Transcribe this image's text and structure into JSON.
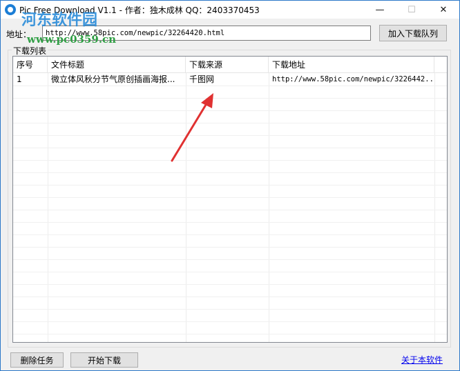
{
  "window": {
    "title": "Pic Free Download V1.1 - 作者：独木成林 QQ：2403370453",
    "controls": {
      "minimize": "—",
      "maximize": "☐",
      "close": "✕"
    }
  },
  "watermark": {
    "text": "河东软件园",
    "url": "www.pc0359.cn"
  },
  "address": {
    "label": "地址：",
    "value": "http://www.58pic.com/newpic/32264420.html",
    "add_button": "加入下载队列"
  },
  "download_list": {
    "legend": "下载列表",
    "columns": [
      "序号",
      "文件标题",
      "下载来源",
      "下载地址"
    ],
    "rows": [
      {
        "index": "1",
        "title": "微立体风秋分节气原创插画海报...",
        "source": "千图网",
        "url": "http://www.58pic.com/newpic/3226442..."
      }
    ]
  },
  "footer": {
    "delete_button": "删除任务",
    "start_button": "开始下载",
    "about_link": "关于本软件"
  },
  "colors": {
    "accent": "#1c7ed6",
    "arrow": "#e03131",
    "link": "#0000ee"
  }
}
